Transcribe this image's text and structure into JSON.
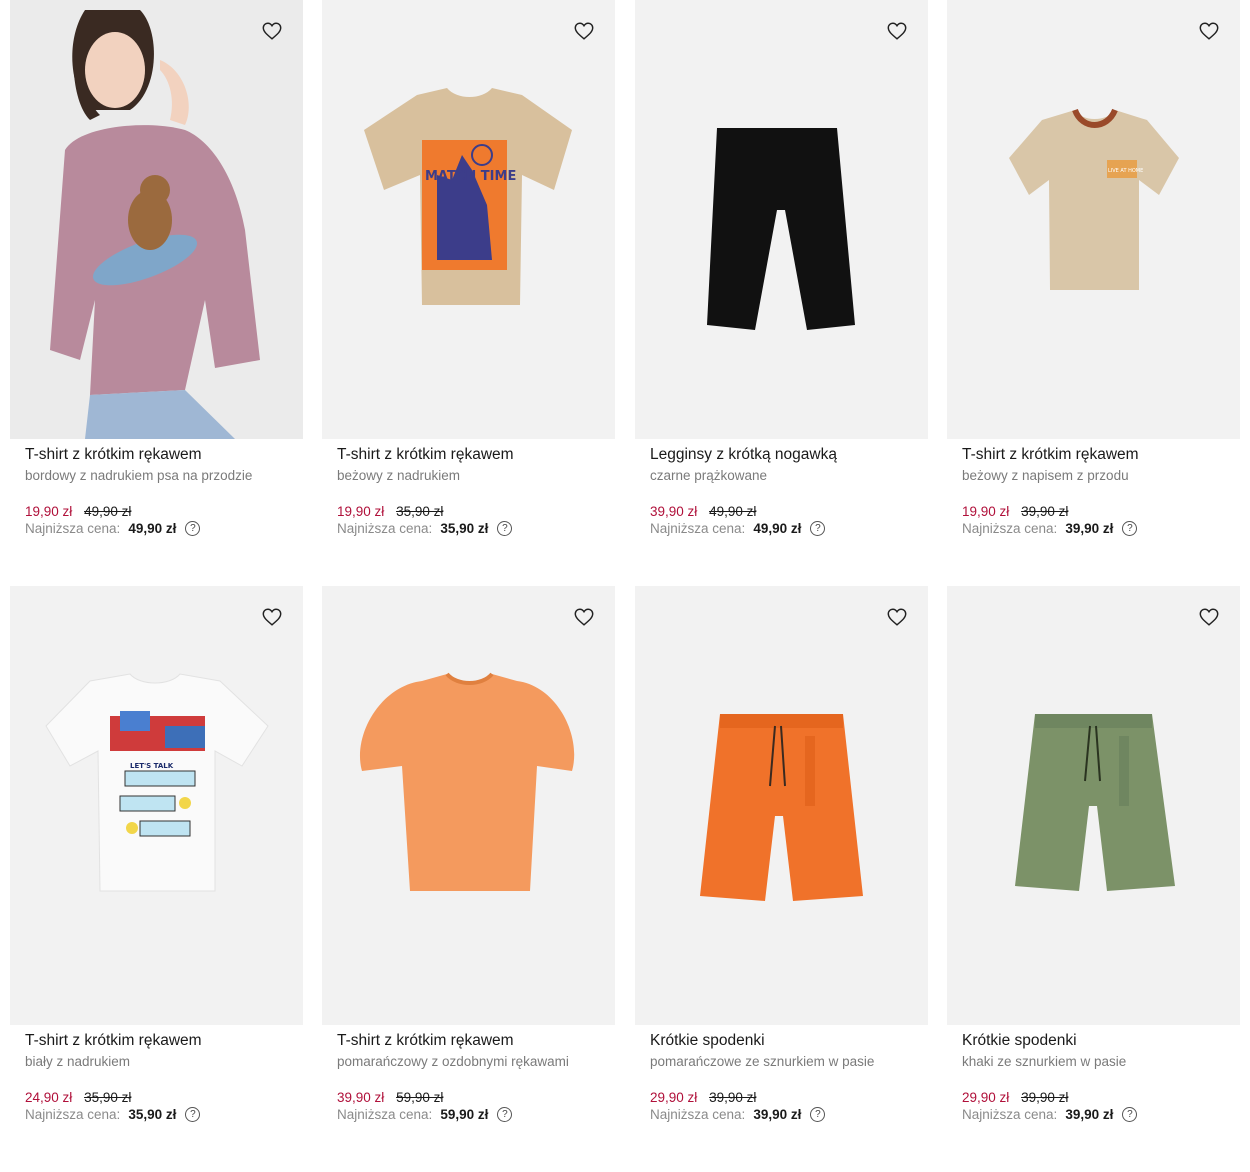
{
  "products": [
    {
      "name": "T-shirt z krótkim rękawem",
      "desc": "bordowy z nadrukiem psa na przodzie",
      "price": "19,90 zł",
      "old_price": "49,90 zł",
      "lowest_label": "Najniższa cena:",
      "lowest_price": "49,90 zł",
      "image": "girl-pink-tshirt"
    },
    {
      "name": "T-shirt z krótkim rękawem",
      "desc": "beżowy z nadrukiem",
      "price": "19,90 zł",
      "old_price": "35,90 zł",
      "lowest_label": "Najniższa cena:",
      "lowest_price": "35,90 zł",
      "image": "beige-tshirt-match-time"
    },
    {
      "name": "Legginsy z krótką nogawką",
      "desc": "czarne prążkowane",
      "price": "39,90 zł",
      "old_price": "49,90 zł",
      "lowest_label": "Najniższa cena:",
      "lowest_price": "49,90 zł",
      "image": "black-leggings"
    },
    {
      "name": "T-shirt z krótkim rękawem",
      "desc": "beżowy z napisem z przodu",
      "price": "19,90 zł",
      "old_price": "39,90 zł",
      "lowest_label": "Najniższa cena:",
      "lowest_price": "39,90 zł",
      "image": "beige-baby-tshirt"
    },
    {
      "name": "T-shirt z krótkim rękawem",
      "desc": "biały z nadrukiem",
      "price": "24,90 zł",
      "old_price": "35,90 zł",
      "lowest_label": "Najniższa cena:",
      "lowest_price": "35,90 zł",
      "image": "white-tshirt-lets-talk"
    },
    {
      "name": "T-shirt z krótkim rękawem",
      "desc": "pomarańczowy z ozdobnymi rękawami",
      "price": "39,90 zł",
      "old_price": "59,90 zł",
      "lowest_label": "Najniższa cena:",
      "lowest_price": "59,90 zł",
      "image": "orange-puff-tshirt"
    },
    {
      "name": "Krótkie spodenki",
      "desc": "pomarańczowe ze sznurkiem w pasie",
      "price": "29,90 zł",
      "old_price": "39,90 zł",
      "lowest_label": "Najniższa cena:",
      "lowest_price": "39,90 zł",
      "image": "orange-shorts"
    },
    {
      "name": "Krótkie spodenki",
      "desc": "khaki ze sznurkiem w pasie",
      "price": "29,90 zł",
      "old_price": "39,90 zł",
      "lowest_label": "Najniższa cena:",
      "lowest_price": "39,90 zł",
      "image": "khaki-shorts"
    }
  ],
  "print_texts": {
    "match_time": "MATCH TIME",
    "lets_talk": "LET'S TALK",
    "live_at_home": "LIVE AT HOME"
  },
  "colors": {
    "sale": "#b0103a",
    "image_bg": "#f2f2f2"
  },
  "icons": {
    "favorite": "heart-outline-icon",
    "help": "question-circle-icon"
  },
  "help_glyph": "?"
}
